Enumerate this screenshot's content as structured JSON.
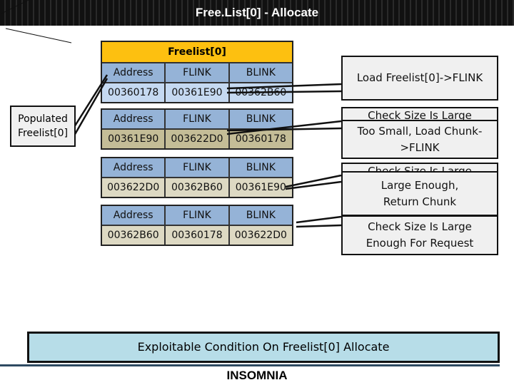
{
  "title": "Free.List[0] - Allocate",
  "freelist_header": "Freelist[0]",
  "columns": [
    "Address",
    "FLINK",
    "BLINK"
  ],
  "tables": [
    {
      "values": [
        "00360178",
        "00361E90",
        "00362B60"
      ],
      "value_color": "#c5d9f1"
    },
    {
      "values": [
        "00361E90",
        "003622D0",
        "00360178"
      ],
      "value_color": "#c4bd97"
    },
    {
      "values": [
        "003622D0",
        "00362B60",
        "00361E90"
      ],
      "value_color": "#ddd9c3"
    },
    {
      "values": [
        "00362B60",
        "00360178",
        "003622D0"
      ],
      "value_color": "#ddd9c3"
    }
  ],
  "callout": "Populated Freelist[0]",
  "steps": {
    "load_flink": "Load Freelist[0]->FLINK",
    "check_hidden_1": "Check Size Is Large",
    "too_small": "Too Small, Load Chunk->FLINK",
    "check_hidden_2": "Check Size Is Large",
    "large_enough": "Large Enough, Return Chunk",
    "check_size": "Check Size Is Large Enough For Request"
  },
  "banner": "Exploitable Condition On Freelist[0] Allocate",
  "logo": "INSOMNIA",
  "colors": {
    "header": "#fdc010",
    "column_header": "#95b3d7",
    "banner": "#b7dde8"
  }
}
